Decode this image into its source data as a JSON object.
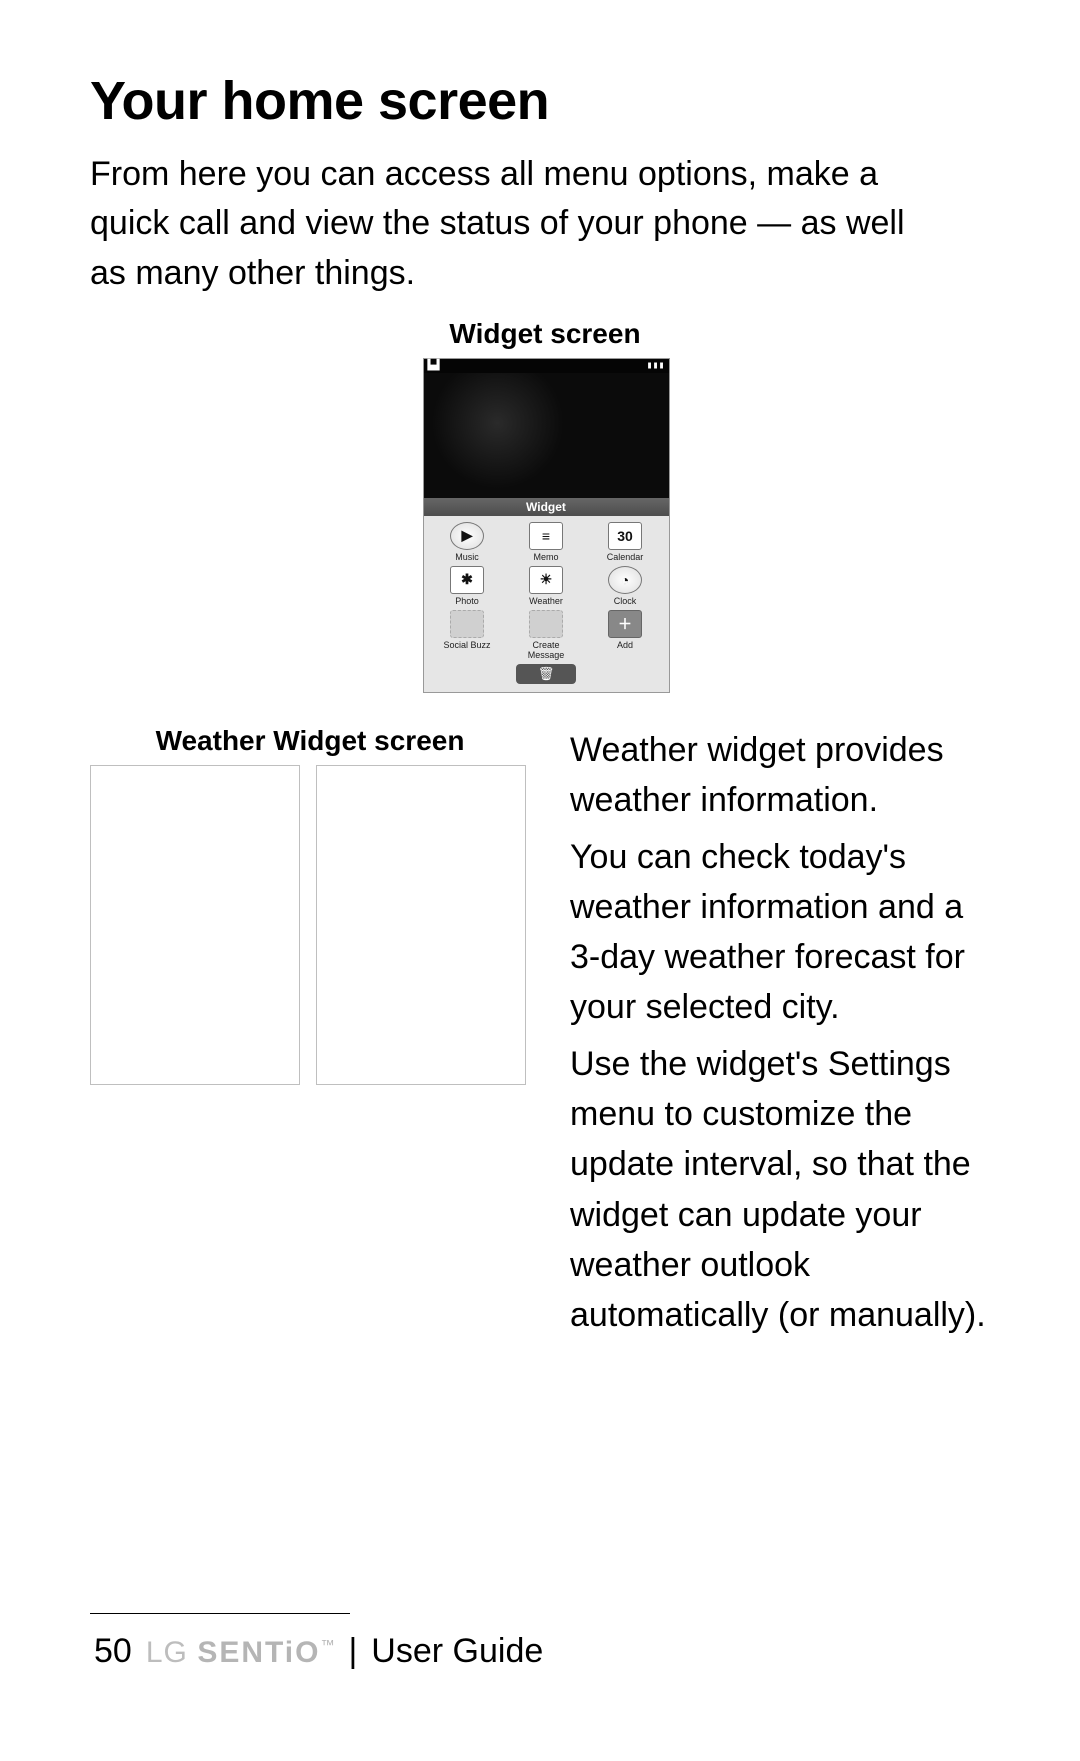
{
  "title": "Your home screen",
  "intro": "From here you can access all menu options, make a quick call and view the status of your phone — as well as many other things.",
  "widget_caption": "Widget screen",
  "phone": {
    "header": "Widget",
    "items": [
      {
        "label": "Music",
        "glyph": "▶"
      },
      {
        "label": "Memo",
        "glyph": "≡"
      },
      {
        "label": "Calendar",
        "glyph": "30"
      },
      {
        "label": "Photo",
        "glyph": "✱"
      },
      {
        "label": "Weather",
        "glyph": "☀"
      },
      {
        "label": "Clock",
        "glyph": "◔"
      },
      {
        "label": "Social Buzz",
        "glyph": ""
      },
      {
        "label": "Create Message",
        "glyph": ""
      },
      {
        "label": "Add",
        "glyph": "＋"
      }
    ],
    "trash_glyph": "🗑"
  },
  "weather_caption": "Weather Widget screen",
  "weather_desc": {
    "p1": "Weather widget provides weather information.",
    "p2": "You can check today's weather information and a 3-day weather forecast for your selected city.",
    "p3": "Use the widget's Settings menu to customize the update interval, so that the widget can update your weather outlook automatically (or manually)."
  },
  "footer": {
    "page_number": "50",
    "brand_lg": "LG",
    "brand_sentio": "SENTiO",
    "trademark": "™",
    "separator": "|",
    "guide": "User Guide"
  }
}
